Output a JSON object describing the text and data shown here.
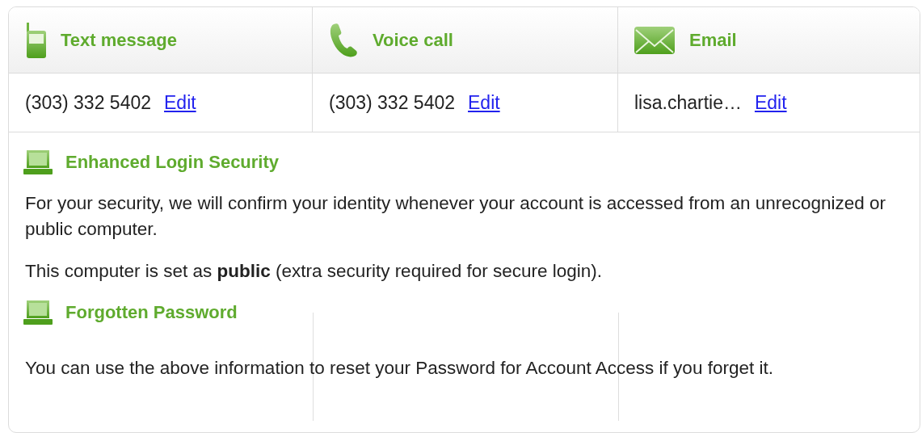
{
  "methods": [
    {
      "kind": "phone",
      "title": "Text message",
      "value": "(303) 332 5402",
      "link": "Edit"
    },
    {
      "kind": "call",
      "title": "Voice call",
      "value": "(303) 332 5402",
      "link": "Edit"
    },
    {
      "kind": "email",
      "title": "Email",
      "value": "lisa.chartie…",
      "link": "Edit"
    }
  ],
  "sections": [
    {
      "title": "Enhanced Login Security",
      "paragraphs": [
        "For your security, we will confirm your identity whenever your account is accessed from an unrecognized or public computer.",
        "This computer is set as **public** (extra security required for secure login)."
      ]
    },
    {
      "title": "Forgotten Password",
      "paragraphs": [
        "You can use the above information to reset your Password for Account Access if you forget it."
      ]
    }
  ]
}
